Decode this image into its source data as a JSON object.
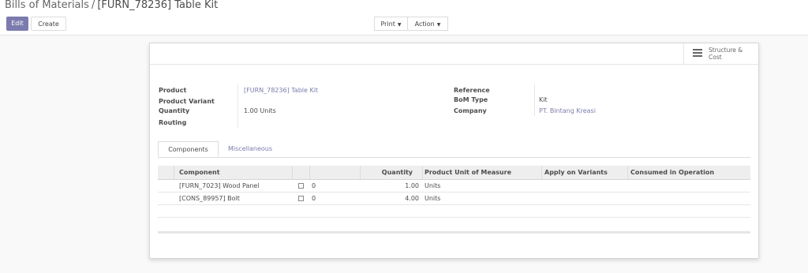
{
  "breadcrumb": {
    "parent": "Bills of Materials",
    "separator": "/",
    "current": "[FURN_78236] Table Kit"
  },
  "toolbar": {
    "edit_label": "Edit",
    "create_label": "Create",
    "print_label": "Print",
    "action_label": "Action"
  },
  "smart_button": {
    "icon": "list-icon",
    "label": "Structure & Cost"
  },
  "form": {
    "product_label": "Product",
    "product_value": "[FURN_78236] Table Kit",
    "variant_label": "Product Variant",
    "quantity_label": "Quantity",
    "quantity_value": "1.00 Units",
    "routing_label": "Routing",
    "reference_label": "Reference",
    "bom_type_label": "BoM Type",
    "bom_type_value": "Kit",
    "company_label": "Company",
    "company_value": "PT. Bintang Kreasi"
  },
  "tabs": [
    {
      "label": "Components"
    },
    {
      "label": "Miscellaneous"
    }
  ],
  "table": {
    "headers": [
      "Component",
      "Quantity",
      "Product Unit of Measure",
      "Apply on Variants",
      "Consumed in Operation"
    ],
    "rows": [
      {
        "component": "[FURN_7023] Wood Panel",
        "icon": "cube-icon",
        "count": "0",
        "quantity": "1.00",
        "uom": "Units"
      },
      {
        "component": "[CONS_89957] Bolt",
        "icon": "cube-icon",
        "count": "0",
        "quantity": "4.00",
        "uom": "Units"
      }
    ]
  }
}
